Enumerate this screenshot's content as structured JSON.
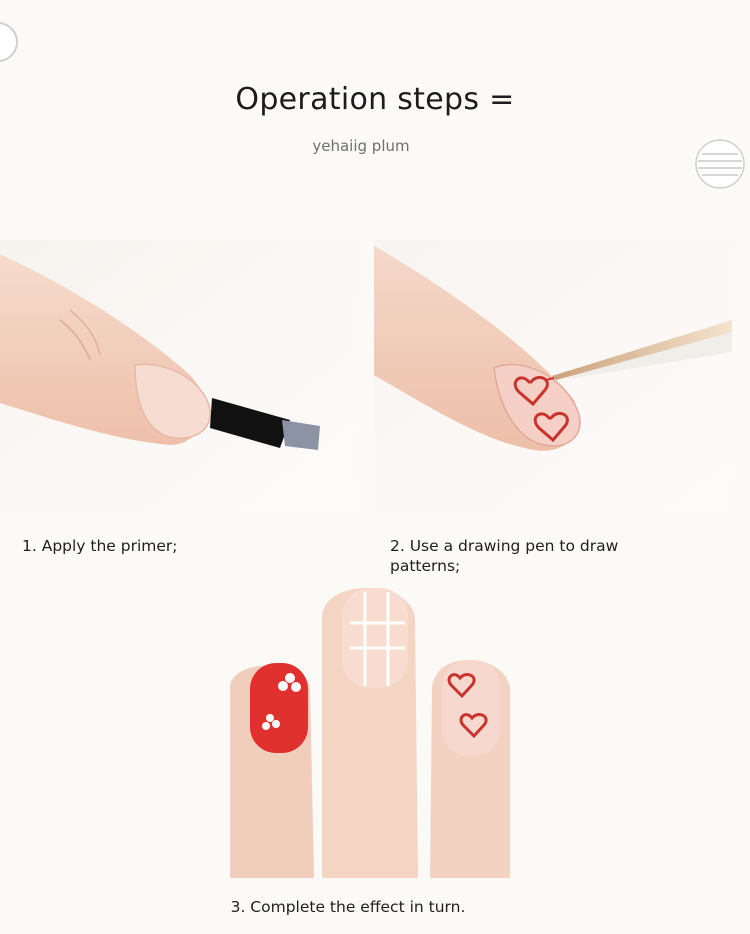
{
  "header": {
    "title": "Operation steps =",
    "subtitle": "yehaiig plum"
  },
  "steps": [
    {
      "caption": "1. Apply the primer;",
      "image": "finger-with-primer-brush"
    },
    {
      "caption": "2. Use a drawing pen to draw patterns;",
      "image": "finger-with-drawing-pen-hearts"
    },
    {
      "caption": "3. Complete the effect in turn.",
      "image": "three-finished-nails"
    }
  ],
  "colors": {
    "background": "#fbfaf6",
    "skin": "#f3d3c3",
    "nail_red": "#e0312f",
    "heart_outline": "#c8332e"
  }
}
